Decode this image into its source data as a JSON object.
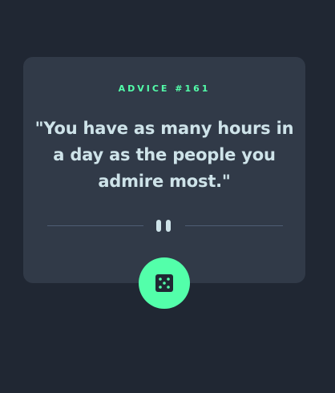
{
  "advice": {
    "number_label": "ADVICE #161",
    "quote": "\"You have as many hours in a day as the people you admire most.\""
  },
  "colors": {
    "background": "#202733",
    "card": "#313a48",
    "accent": "#53ffaa",
    "text": "#cee3e9",
    "divider": "#4f5d74"
  },
  "icons": {
    "divider_center": "pause-icon",
    "generate_button": "dice-icon"
  }
}
